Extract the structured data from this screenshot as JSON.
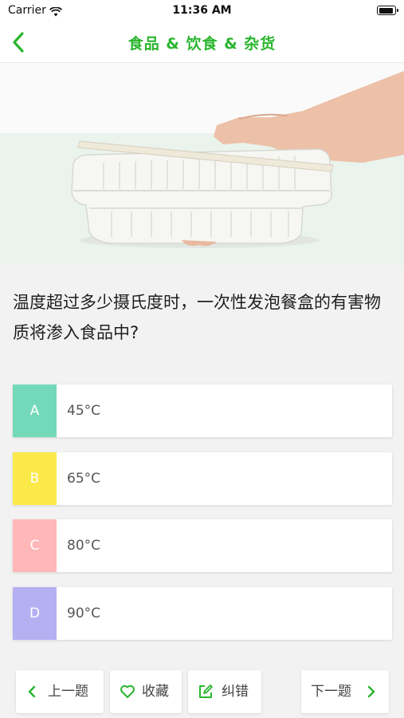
{
  "status_bar": {
    "carrier": "Carrier",
    "time": "11:36 AM"
  },
  "nav": {
    "title": "食品 & 饮食 & 杂货",
    "back_icon": "chevron-left-icon"
  },
  "question": {
    "text": "温度超过多少摄氏度时，一次性发泡餐盒的有害物质将渗入食品中?"
  },
  "options": [
    {
      "letter": "A",
      "text": "45°C",
      "color": "#73d9b8"
    },
    {
      "letter": "B",
      "text": "65°C",
      "color": "#fbe94a"
    },
    {
      "letter": "C",
      "text": "80°C",
      "color": "#ffb7b7"
    },
    {
      "letter": "D",
      "text": "90°C",
      "color": "#b5b0f2"
    }
  ],
  "bottom_bar": {
    "prev_label": "上一题",
    "favorite_label": "收藏",
    "report_label": "纠错",
    "next_label": "下一题"
  },
  "colors": {
    "accent": "#29b52d"
  }
}
